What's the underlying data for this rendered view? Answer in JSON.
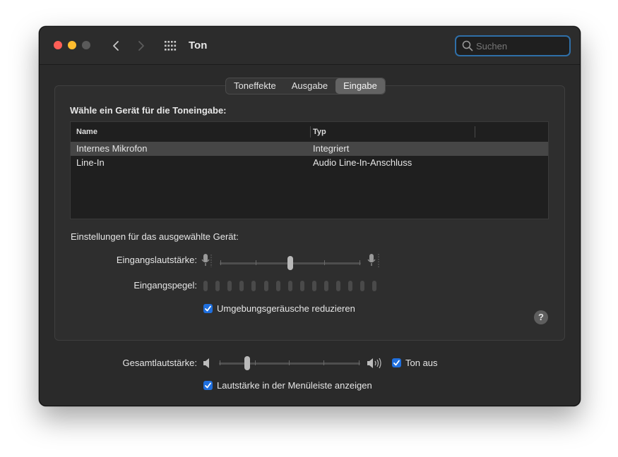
{
  "window": {
    "title": "Ton",
    "search": {
      "placeholder": "Suchen",
      "value": ""
    }
  },
  "tabs": [
    {
      "label": "Toneffekte",
      "active": false
    },
    {
      "label": "Ausgabe",
      "active": false
    },
    {
      "label": "Eingabe",
      "active": true
    }
  ],
  "device_section": {
    "title": "Wähle ein Gerät für die Toneingabe:",
    "columns": [
      "Name",
      "Typ"
    ],
    "rows": [
      {
        "name": "Internes Mikrofon",
        "type": "Integriert",
        "selected": true
      },
      {
        "name": "Line-In",
        "type": "Audio Line-In-Anschluss",
        "selected": false
      }
    ]
  },
  "settings": {
    "title": "Einstellungen für das ausgewählte Gerät:",
    "input_volume_label": "Eingangslautstärke:",
    "input_volume_value": 0.5,
    "input_level_label": "Eingangspegel:",
    "input_level_value": 0,
    "noise_reduction_label": "Umgebungsgeräusche reduzieren",
    "noise_reduction_checked": true,
    "help_label": "?"
  },
  "output": {
    "volume_label": "Gesamtlautstärke:",
    "volume_value": 0.2,
    "mute_label": "Ton aus",
    "mute_checked": true,
    "menubar_label": "Lautstärke in der Menüleiste anzeigen",
    "menubar_checked": true
  },
  "colors": {
    "accent": "#1f6fde",
    "traffic_red": "#ff5f57",
    "traffic_yellow": "#febc2e",
    "search_focus": "#2f6fa8"
  }
}
